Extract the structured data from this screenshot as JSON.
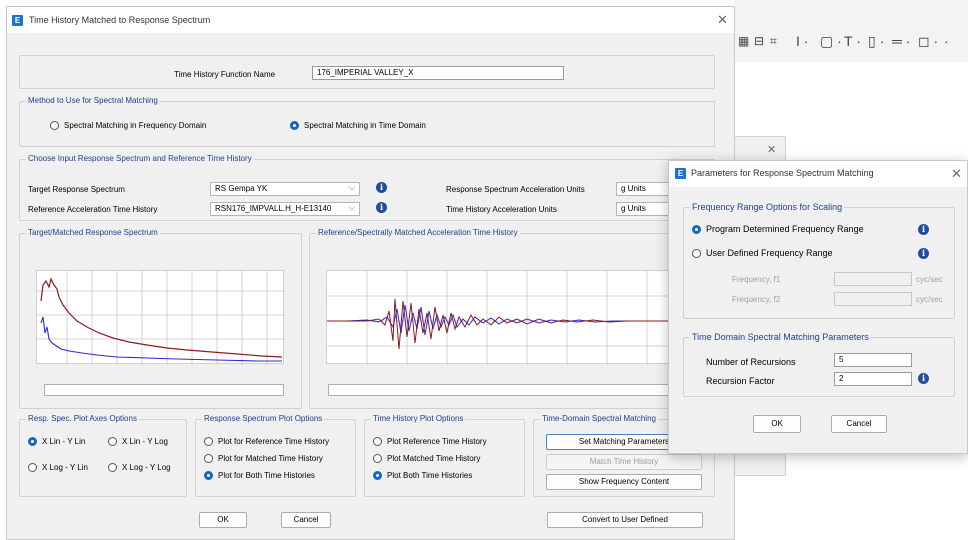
{
  "bg_window": {
    "toolbar_icons": [
      "grid-icon",
      "text-cursor-icon",
      "frame-icon",
      "tee-icon",
      "section-icon",
      "line-style-icon",
      "box-icon"
    ]
  },
  "main_dialog": {
    "title": "Time History Matched to Response Spectrum",
    "function_name_label": "Time History Function Name",
    "function_name_value": "176_IMPERIAL VALLEY_X",
    "method_group": {
      "title": "Method to Use for Spectral Matching",
      "options": [
        "Spectral Matching in Frequency Domain",
        "Spectral Matching in Time Domain"
      ],
      "selected": 1
    },
    "input_group": {
      "title": "Choose Input Response Spectrum and Reference Time History",
      "target_label": "Target Response Spectrum",
      "target_value": "RS Gempa YK",
      "reference_label": "Reference Acceleration Time History",
      "reference_value": "RSN176_IMPVALL.H_H-E13140",
      "rs_units_label": "Response Spectrum Acceleration Units",
      "rs_units_value": "g Units",
      "th_units_label": "Time History Acceleration Units",
      "th_units_value": "g Units"
    },
    "spectrum_plot_title": "Target/Matched Response Spectrum",
    "history_plot_title": "Reference/Spectrally Matched Acceleration Time History",
    "axes_group": {
      "title": "Resp. Spec. Plot Axes Options",
      "options": [
        "X Lin - Y Lin",
        "X Lin - Y Log",
        "X Log - Y Lin",
        "X Log - Y Log"
      ],
      "selected": 0
    },
    "rs_plot_group": {
      "title": "Response Spectrum Plot Options",
      "options": [
        "Plot for Reference Time History",
        "Plot for Matched Time History",
        "Plot for Both Time Histories"
      ],
      "selected": 2
    },
    "th_plot_group": {
      "title": "Time History Plot Options",
      "options": [
        "Plot Reference Time History",
        "Plot Matched Time History",
        "Plot Both Time Histories"
      ],
      "selected": 2
    },
    "td_group": {
      "title": "Time-Domain Spectral Matching",
      "set_params": "Set Matching Parameters",
      "match": "Match Time History",
      "show_freq": "Show Frequency Content"
    },
    "ok": "OK",
    "cancel": "Cancel",
    "convert": "Convert to User Defined",
    "colors": {
      "reference": "#8b1a1a",
      "matched": "#2a2ae0"
    }
  },
  "params_dialog": {
    "title": "Parameters for Response Spectrum Matching",
    "freq_group_title": "Frequency Range Options for Scaling",
    "freq_options": [
      "Program Determined Frequency Range",
      "User Defined Frequency Range"
    ],
    "freq_selected": 0,
    "f1_label": "Frequency, f1",
    "f2_label": "Frequency, f2",
    "unit": "cyc/sec",
    "td_group_title": "Time Domain Spectral Matching Parameters",
    "recursions_label": "Number of Recursions",
    "recursions_value": "5",
    "factor_label": "Recursion Factor",
    "factor_value": "2",
    "ok": "OK",
    "cancel": "Cancel"
  }
}
